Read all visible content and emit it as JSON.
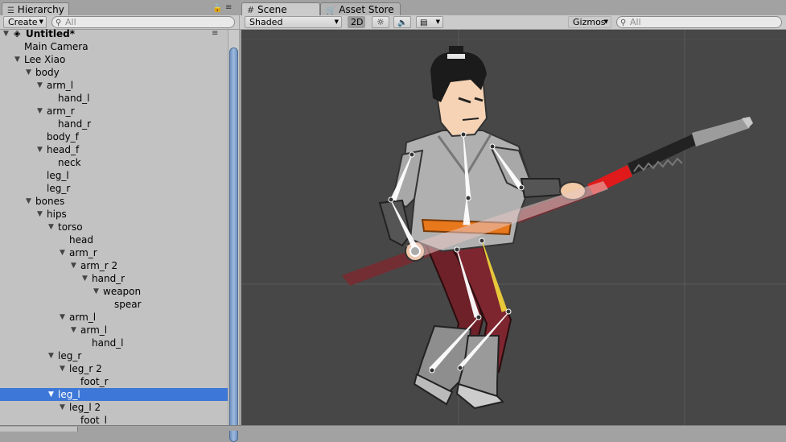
{
  "hierarchy": {
    "tab_label": "Hierarchy",
    "create_label": "Create",
    "search_placeholder": "All",
    "scene_name": "Untitled*",
    "tree": [
      {
        "label": "Main Camera",
        "depth": 1,
        "arrow": false,
        "selected": false
      },
      {
        "label": "Lee Xiao",
        "depth": 1,
        "arrow": true,
        "selected": false
      },
      {
        "label": "body",
        "depth": 2,
        "arrow": true,
        "selected": false
      },
      {
        "label": "arm_l",
        "depth": 3,
        "arrow": true,
        "selected": false
      },
      {
        "label": "hand_l",
        "depth": 4,
        "arrow": false,
        "selected": false
      },
      {
        "label": "arm_r",
        "depth": 3,
        "arrow": true,
        "selected": false
      },
      {
        "label": "hand_r",
        "depth": 4,
        "arrow": false,
        "selected": false
      },
      {
        "label": "body_f",
        "depth": 3,
        "arrow": false,
        "selected": false
      },
      {
        "label": "head_f",
        "depth": 3,
        "arrow": true,
        "selected": false
      },
      {
        "label": "neck",
        "depth": 4,
        "arrow": false,
        "selected": false
      },
      {
        "label": "leg_l",
        "depth": 3,
        "arrow": false,
        "selected": false
      },
      {
        "label": "leg_r",
        "depth": 3,
        "arrow": false,
        "selected": false
      },
      {
        "label": "bones",
        "depth": 2,
        "arrow": true,
        "selected": false
      },
      {
        "label": "hips",
        "depth": 3,
        "arrow": true,
        "selected": false
      },
      {
        "label": "torso",
        "depth": 4,
        "arrow": true,
        "selected": false
      },
      {
        "label": "head",
        "depth": 5,
        "arrow": false,
        "selected": false
      },
      {
        "label": "arm_r",
        "depth": 5,
        "arrow": true,
        "selected": false
      },
      {
        "label": "arm_r 2",
        "depth": 6,
        "arrow": true,
        "selected": false
      },
      {
        "label": "hand_r",
        "depth": 7,
        "arrow": true,
        "selected": false
      },
      {
        "label": "weapon",
        "depth": 8,
        "arrow": true,
        "selected": false
      },
      {
        "label": "spear",
        "depth": 9,
        "arrow": false,
        "selected": false
      },
      {
        "label": "arm_l",
        "depth": 5,
        "arrow": true,
        "selected": false
      },
      {
        "label": "arm_l",
        "depth": 6,
        "arrow": true,
        "selected": false
      },
      {
        "label": "hand_l",
        "depth": 7,
        "arrow": false,
        "selected": false
      },
      {
        "label": "leg_r",
        "depth": 4,
        "arrow": true,
        "selected": false
      },
      {
        "label": "leg_r 2",
        "depth": 5,
        "arrow": true,
        "selected": false
      },
      {
        "label": "foot_r",
        "depth": 6,
        "arrow": false,
        "selected": false
      },
      {
        "label": "leg_l",
        "depth": 4,
        "arrow": true,
        "selected": true
      },
      {
        "label": "leg_l 2",
        "depth": 5,
        "arrow": true,
        "selected": false
      },
      {
        "label": "foot_l",
        "depth": 6,
        "arrow": false,
        "selected": false
      }
    ]
  },
  "scene": {
    "tab_label": "Scene",
    "asset_store_label": "Asset Store",
    "shading_mode": "Shaded",
    "mode_2d": "2D",
    "gizmos_label": "Gizmos",
    "search_placeholder": "All"
  },
  "colors": {
    "selection": "#3d78d8",
    "viewport_bg": "#474747",
    "bone_selected": "#f0d23c"
  }
}
